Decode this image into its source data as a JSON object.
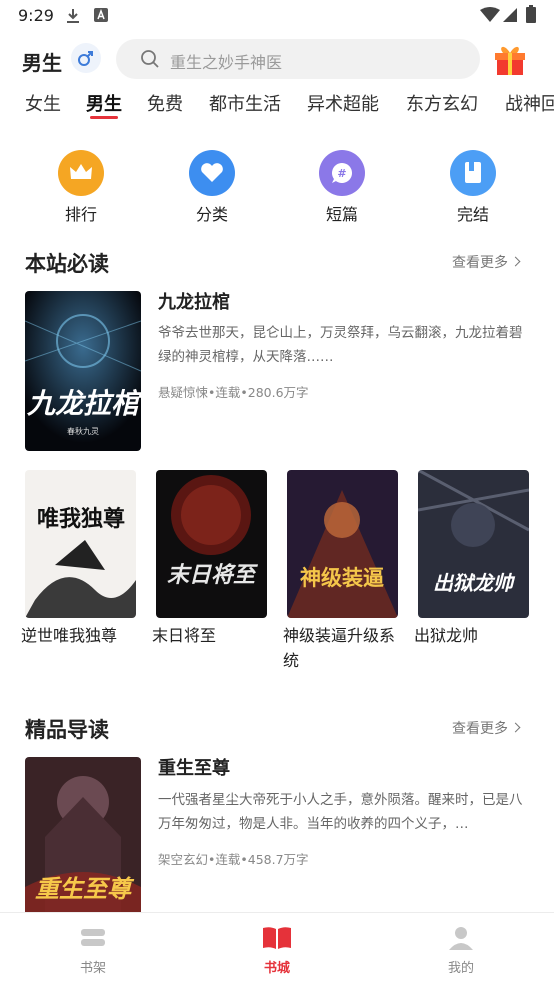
{
  "status_bar": {
    "time": "9:29"
  },
  "header": {
    "gender_label": "男生",
    "search_placeholder": "重生之妙手神医"
  },
  "tabs": [
    {
      "label": "女生"
    },
    {
      "label": "男生",
      "active": true
    },
    {
      "label": "免费"
    },
    {
      "label": "都市生活"
    },
    {
      "label": "异术超能"
    },
    {
      "label": "东方玄幻"
    },
    {
      "label": "战神回"
    }
  ],
  "quick_entries": [
    {
      "label": "排行",
      "icon": "crown-icon",
      "color": "#f5a623"
    },
    {
      "label": "分类",
      "icon": "heart-icon",
      "color": "#3d8ef0"
    },
    {
      "label": "短篇",
      "icon": "hash-chat-icon",
      "color": "#8b78e8"
    },
    {
      "label": "完结",
      "icon": "book-icon",
      "color": "#4c9ef5"
    }
  ],
  "section_must_read": {
    "title": "本站必读",
    "more": "查看更多",
    "featured": {
      "title": "九龙拉棺",
      "desc": "爷爷去世那天，昆仑山上，万灵祭拜，乌云翻滚，九龙拉着碧绿的神灵棺椁，从天降落……",
      "meta": "悬疑惊悚•连载•280.6万字",
      "cover_text": "九龙拉棺",
      "cover_author": "春秋九灵"
    },
    "grid": [
      {
        "title": "逆世唯我独尊",
        "cover_text": "唯我独尊"
      },
      {
        "title": "末日将至",
        "cover_text": "末日将至"
      },
      {
        "title": "神级装逼升级系统",
        "cover_text": "神级装逼"
      },
      {
        "title": "出狱龙帅",
        "cover_text": "出狱龙帅"
      }
    ]
  },
  "section_premium": {
    "title": "精品导读",
    "more": "查看更多",
    "featured": {
      "title": "重生至尊",
      "desc": "一代强者星尘大帝死于小人之手，意外陨落。醒来时，已是八万年匆匆过，物是人非。当年的收养的四个义子，…",
      "meta": "架空玄幻•连载•458.7万字",
      "cover_text": "重生至尊"
    }
  },
  "bottom_nav": [
    {
      "label": "书架",
      "icon": "bookshelf-icon"
    },
    {
      "label": "书城",
      "icon": "open-book-icon",
      "active": true
    },
    {
      "label": "我的",
      "icon": "user-icon"
    }
  ],
  "colors": {
    "accent": "#e5323a"
  }
}
